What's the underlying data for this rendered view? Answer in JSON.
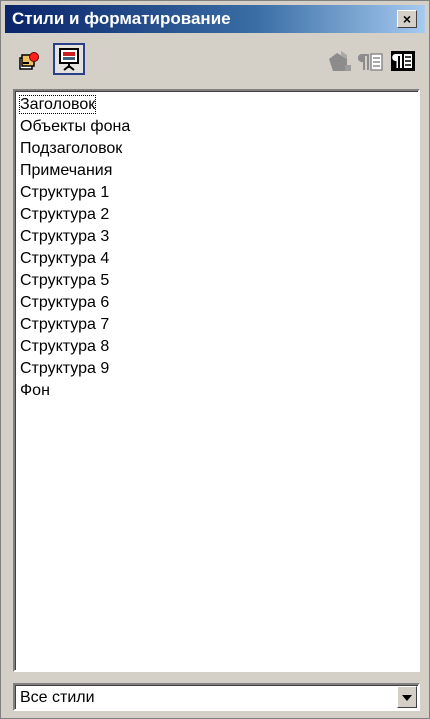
{
  "window": {
    "title": "Стили и форматирование",
    "close_glyph": "×"
  },
  "toolbar": {
    "icons": [
      "paragraph-styles-icon",
      "presentation-styles-icon",
      "fill-format-mode-icon",
      "new-style-from-selection-icon",
      "update-style-icon"
    ]
  },
  "style_list": {
    "items": [
      "Заголовок",
      "Объекты фона",
      "Подзаголовок",
      "Примечания",
      "Структура 1",
      "Структура 2",
      "Структура 3",
      "Структура 4",
      "Структура 5",
      "Структура 6",
      "Структура 7",
      "Структура 8",
      "Структура 9",
      "Фон"
    ]
  },
  "filter": {
    "selected": "Все стили"
  },
  "colors": {
    "titlebar_start": "#0a246a",
    "titlebar_end": "#a6caf0",
    "window_bg": "#d4d0c8",
    "pressed_border": "#2c3f8c"
  }
}
